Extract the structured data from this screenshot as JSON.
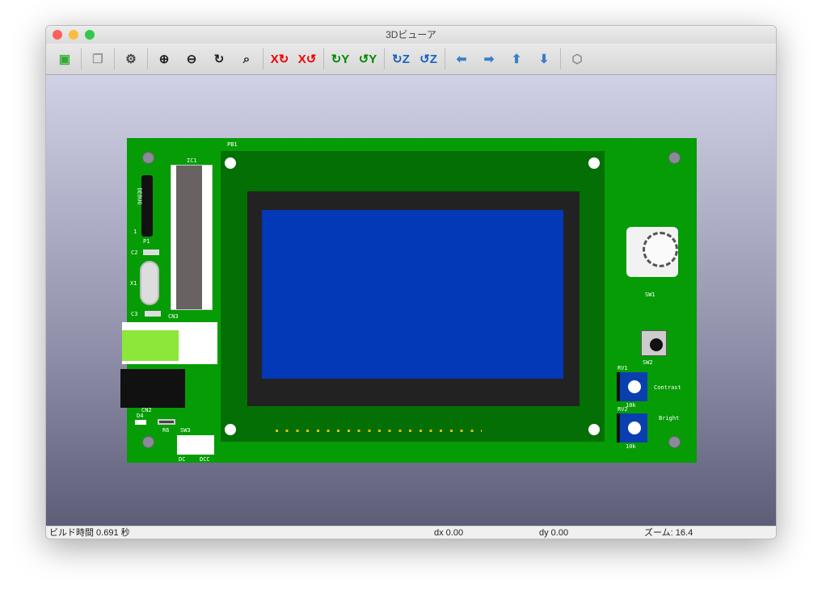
{
  "window": {
    "title": "3Dビューア"
  },
  "toolbar": {
    "buttons": [
      {
        "name": "export-icon",
        "glyph": "▣",
        "color": "#3a3"
      },
      {
        "name": "copy-icon",
        "glyph": "❐",
        "color": "#999"
      },
      {
        "name": "settings-icon",
        "glyph": "⚙",
        "color": "#444"
      },
      {
        "name": "zoom-in-icon",
        "glyph": "⊕",
        "color": "#222"
      },
      {
        "name": "zoom-out-icon",
        "glyph": "⊖",
        "color": "#222"
      },
      {
        "name": "redraw-icon",
        "glyph": "↻",
        "color": "#222"
      },
      {
        "name": "zoom-fit-icon",
        "glyph": "⌕",
        "color": "#222"
      },
      {
        "name": "rotate-x-cw-icon",
        "glyph": "X↻",
        "color": "#e00"
      },
      {
        "name": "rotate-x-ccw-icon",
        "glyph": "X↺",
        "color": "#e00"
      },
      {
        "name": "rotate-y-cw-icon",
        "glyph": "↻Y",
        "color": "#080"
      },
      {
        "name": "rotate-y-ccw-icon",
        "glyph": "↺Y",
        "color": "#080"
      },
      {
        "name": "rotate-z-cw-icon",
        "glyph": "↻Z",
        "color": "#1a5fc0"
      },
      {
        "name": "rotate-z-ccw-icon",
        "glyph": "↺Z",
        "color": "#1a5fc0"
      },
      {
        "name": "move-left-icon",
        "glyph": "⬅",
        "color": "#3a7fc8"
      },
      {
        "name": "move-right-icon",
        "glyph": "➡",
        "color": "#3a7fc8"
      },
      {
        "name": "move-up-icon",
        "glyph": "⬆",
        "color": "#3a7fc8"
      },
      {
        "name": "move-down-icon",
        "glyph": "⬇",
        "color": "#3a7fc8"
      },
      {
        "name": "ortho-view-icon",
        "glyph": "⬡",
        "color": "#888"
      }
    ]
  },
  "pcb": {
    "labels": {
      "pb1": "PB1",
      "ic1": "IC1",
      "debug": "DEBUG",
      "one": "1",
      "p1": "P1",
      "c2": "C2",
      "x1": "X1",
      "c3": "C3",
      "cn3": "CN3",
      "cn2": "CN2",
      "d4": "D4",
      "r6": "R6",
      "sw3": "SW3",
      "dc": "DC",
      "dcc": "DCC",
      "sw1": "SW1",
      "sw2": "SW2",
      "rv1": "RV1",
      "rv2": "RV2",
      "contrast": "Contrast",
      "bright": "Bright",
      "rv1_value": "10k",
      "rv2_value": "10k"
    }
  },
  "status": {
    "build_time": "ビルド時間 0.691 秒",
    "dx": "dx 0.00",
    "dy": "dy 0.00",
    "zoom": "ズーム: 16.4"
  }
}
